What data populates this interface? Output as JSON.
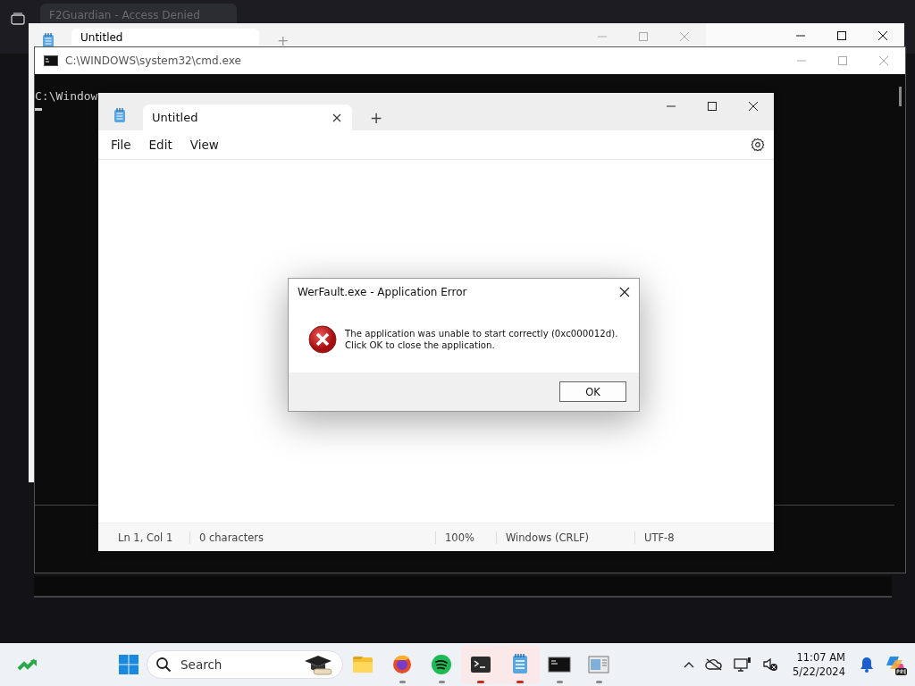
{
  "browser_window": {
    "tab": "F2Guardian - Access Denied"
  },
  "back_notepad": {
    "tab": "Untitled",
    "new_tab": "+"
  },
  "cmd_window": {
    "title": "C:\\WINDOWS\\system32\\cmd.exe",
    "line": "C:\\Window"
  },
  "notepad": {
    "tab": "Untitled",
    "new_tab": "+",
    "menu": [
      "File",
      "Edit",
      "View"
    ],
    "status": [
      "Ln 1, Col 1",
      "0 characters",
      "100%",
      "Windows (CRLF)",
      "UTF-8"
    ]
  },
  "dialog": {
    "title": "WerFault.exe - Application Error",
    "message": [
      "The application was unable to start correctly (0xc000012d).",
      "Click OK to close the application."
    ],
    "buttons": [
      "OK"
    ]
  },
  "taskbar": {
    "search_placeholder": "Search",
    "apps": [
      {
        "kind": "explorer",
        "running": false,
        "active": false
      },
      {
        "kind": "firefox",
        "running": true,
        "active": false
      },
      {
        "kind": "spotify",
        "running": true,
        "active": false
      },
      {
        "kind": "terminal",
        "running": true,
        "active": true
      },
      {
        "kind": "notepad",
        "running": true,
        "active": true
      },
      {
        "kind": "cmd",
        "running": true,
        "active": false
      },
      {
        "kind": "viewer",
        "running": true,
        "active": false
      }
    ],
    "time": "11:07 AM",
    "date": "5/22/2024"
  }
}
